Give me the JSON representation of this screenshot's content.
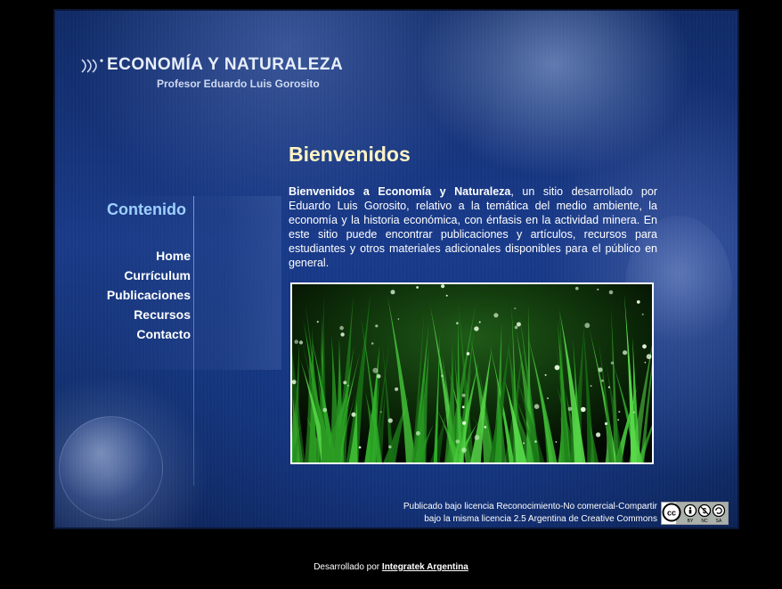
{
  "header": {
    "title": "ECONOMÍA Y NATURALEZA",
    "subtitle": "Profesor Eduardo Luis Gorosito",
    "logo_icon": "sound-waves-icon"
  },
  "sidebar": {
    "heading": "Contenido",
    "items": [
      {
        "label": "Home"
      },
      {
        "label": "Currículum"
      },
      {
        "label": "Publicaciones"
      },
      {
        "label": "Recursos"
      },
      {
        "label": "Contacto"
      }
    ]
  },
  "main": {
    "title": "Bienvenidos",
    "intro_bold": "Bienvenidos a Economía y Naturaleza",
    "intro_rest": ", un sitio desarrollado por Eduardo Luis Gorosito, relativo a la temática del medio ambiente, la economía y la historia económica, con énfasis en la actividad minera. En este sitio puede encontrar publicaciones y artículos, recursos para estudiantes y otros materiales adicionales disponibles para el público en general."
  },
  "license": {
    "line1": "Publicado bajo licencia Reconocimiento-No comercial-Compartir",
    "line2": "bajo la misma licencia 2.5 Argentina de Creative Commons",
    "badge_labels": [
      "BY",
      "NC",
      "SA"
    ]
  },
  "footer": {
    "prefix": "Desarrollado por ",
    "link": "Integratek Argentina"
  },
  "colors": {
    "page_bg": "#000000",
    "frame_blue": "#1a3a88",
    "heading_cyan": "#9ed0ff",
    "title_cream": "#fff4c4",
    "grass_green": "#2fae2a"
  }
}
